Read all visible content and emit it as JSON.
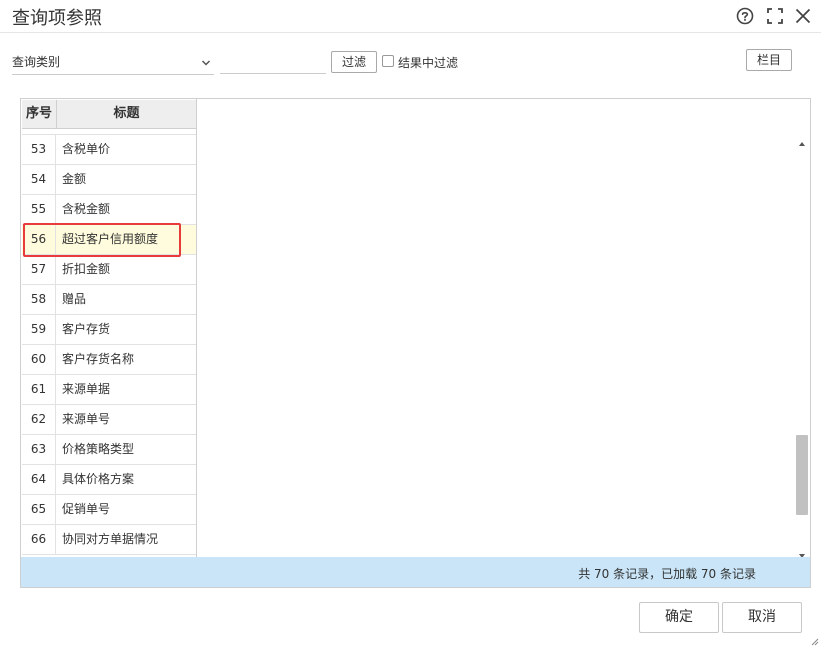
{
  "dialog": {
    "title": "查询项参照",
    "icons": [
      "help-icon",
      "maximize-icon",
      "close-icon"
    ]
  },
  "toolbar": {
    "category_label": "查询类别",
    "filter_value": "",
    "filter_button": "过滤",
    "filter_in_results_label": "结果中过滤",
    "filter_in_results_checked": false,
    "columns_button": "栏目"
  },
  "grid": {
    "headers": {
      "seq": "序号",
      "title": "标题"
    },
    "rows": [
      {
        "seq": "53",
        "title": "含税单价"
      },
      {
        "seq": "54",
        "title": "金额"
      },
      {
        "seq": "55",
        "title": "含税金额"
      },
      {
        "seq": "56",
        "title": "超过客户信用额度",
        "selected": true
      },
      {
        "seq": "57",
        "title": "折扣金额"
      },
      {
        "seq": "58",
        "title": "赠品"
      },
      {
        "seq": "59",
        "title": "客户存货"
      },
      {
        "seq": "60",
        "title": "客户存货名称"
      },
      {
        "seq": "61",
        "title": "来源单据"
      },
      {
        "seq": "62",
        "title": "来源单号"
      },
      {
        "seq": "63",
        "title": "价格策略类型"
      },
      {
        "seq": "64",
        "title": "具体价格方案"
      },
      {
        "seq": "65",
        "title": "促销单号"
      },
      {
        "seq": "66",
        "title": "协同对方单据情况"
      }
    ],
    "status": "共 70 条记录，已加载 70 条记录"
  },
  "footer": {
    "ok_button": "确定",
    "cancel_button": "取消"
  },
  "colors": {
    "selected_row": "#fffbdd",
    "highlight_border": "#e83b3b",
    "status_bar": "#c9e5f7",
    "header_bg": "#eeeeee"
  }
}
